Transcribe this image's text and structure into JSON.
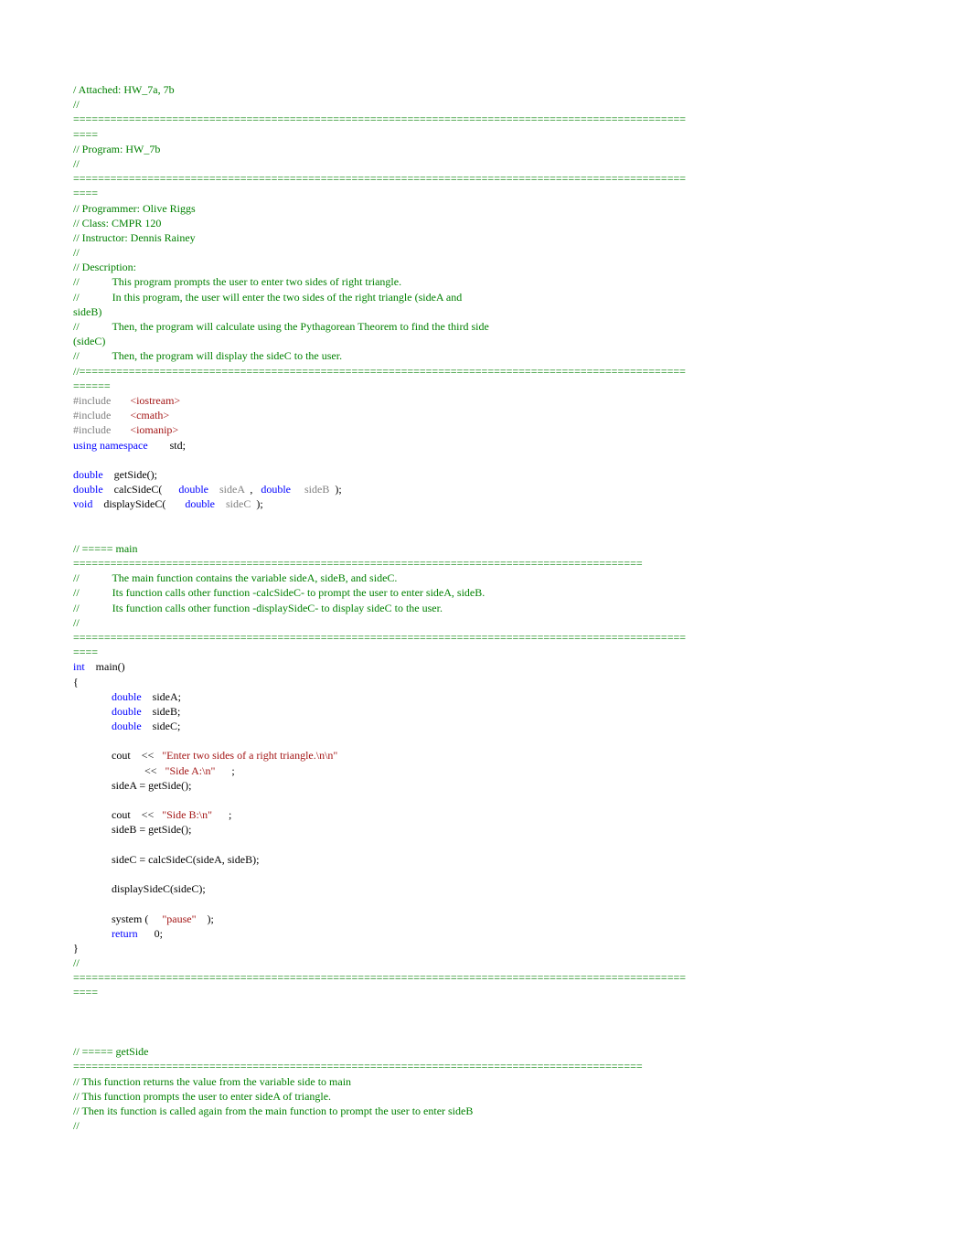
{
  "line01a": "/ Attached: HW_7a, 7b",
  "line02a": "//",
  "rule99": "===================================================================================================",
  "rule4": "====",
  "line04a": "// Program: HW_7b",
  "line05a": "//",
  "line07a": "// Programmer: Olive Riggs",
  "line07b": "// Class: CMPR 120",
  "line07c": "// Instructor: Dennis Rainey",
  "line08a": "//",
  "line09a": "// Description:",
  "line10a": "//",
  "line10b": "This program prompts the user to enter two sides of right triangle.",
  "line11a": "//",
  "line11b": "In this program, the user will enter the two sides of the right triangle (sideA and",
  "line12a": "sideB)",
  "line13a": "//",
  "line13b": "Then, the program will calculate using the Pythagorean Theorem to find the third side",
  "line14a": "(sideC)",
  "line15a": "//",
  "line15b": "Then, the program will display the sideC to the user.",
  "line16a": "//==================================================================================================",
  "rule6": "======",
  "incl": "#include",
  "hdr_io": "<iostream>",
  "hdr_cm": "<cmath>",
  "hdr_im": "<iomanip>",
  "using": "using namespace",
  "std": "std;",
  "double": "double",
  "void": "void",
  "int": "int",
  "return": "return",
  "proto1": "getSide();",
  "proto2a": "calcSideC(",
  "proto2b": "sideA",
  "proto2c": ",",
  "proto2d": "sideB",
  "proto2e": ");",
  "proto3a": "displaySideC(",
  "proto3b": "sideC",
  "proto3c": ");",
  "sec_main": "// ===== main",
  "rule92": "============================================================================================",
  "mcom1a": "//",
  "mcom1b": "The main function contains the variable sideA, sideB, and sideC.",
  "mcom2a": "//",
  "mcom2b": "Its function calls other function -calcSideC- to prompt the user to enter sideA, sideB.",
  "mcom3a": "//",
  "mcom3b": "Its function calls other function -displaySideC- to display sideC to the user.",
  "mcom4": "//",
  "mainfn": "main()",
  "lbrace": "{",
  "rbrace": "}",
  "sideA": "sideA;",
  "sideB": "sideB;",
  "sideC": "sideC;",
  "cout": "cout",
  "op_ins": "<<",
  "str1": "\"Enter two sides of a right triangle.\\n\\n\"",
  "str2": "\"Side A:\\n\"",
  "semi": ";",
  "assignA": "sideA = getSide();",
  "str3": "\"Side B:\\n\"",
  "assignB": "sideB = getSide();",
  "assignC": "sideC = calcSideC(sideA, sideB);",
  "dispC": "displaySideC(sideC);",
  "sys": "system (",
  "strP": "\"pause\"",
  "sysEnd": ");",
  "ret0": "0;",
  "endcm": "//",
  "sec_get": "// ===== getSide",
  "getcom1": "// This function returns the value from the variable side to main",
  "getcom2": "// This function prompts the user to enter sideA of triangle.",
  "getcom3": "// Then its function is called again from the main function to prompt the user to enter sideB",
  "getcom4": "//"
}
